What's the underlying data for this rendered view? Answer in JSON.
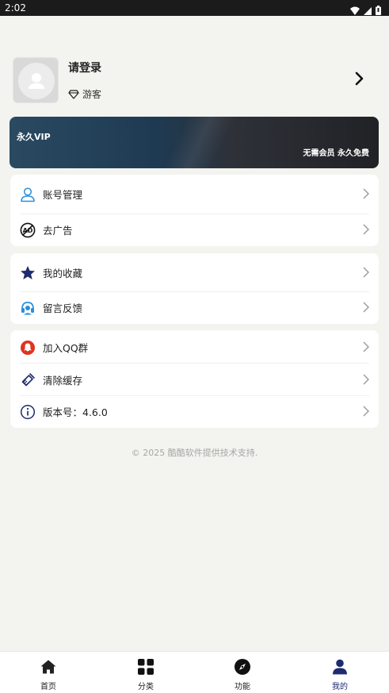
{
  "status_bar": {
    "time": "2:02"
  },
  "profile": {
    "name": "请登录",
    "role": "游客"
  },
  "vip": {
    "title": "永久VIP",
    "subtitle": "无需会员 永久免费"
  },
  "menu": {
    "account": "账号管理",
    "remove_ads": "去广告",
    "favorites": "我的收藏",
    "feedback": "留言反馈",
    "join_qq": "加入QQ群",
    "clear_cache": "清除缓存",
    "version": "版本号：4.6.0"
  },
  "footer": {
    "text": "© 2025 酷酷软件提供技术支持."
  },
  "tabbar": {
    "home": "首页",
    "category": "分类",
    "features": "功能",
    "mine": "我的",
    "active": "我的"
  },
  "colors": {
    "accent": "#1e2b6e",
    "qq_red": "#e0331e",
    "link_blue": "#2a8fd9"
  }
}
